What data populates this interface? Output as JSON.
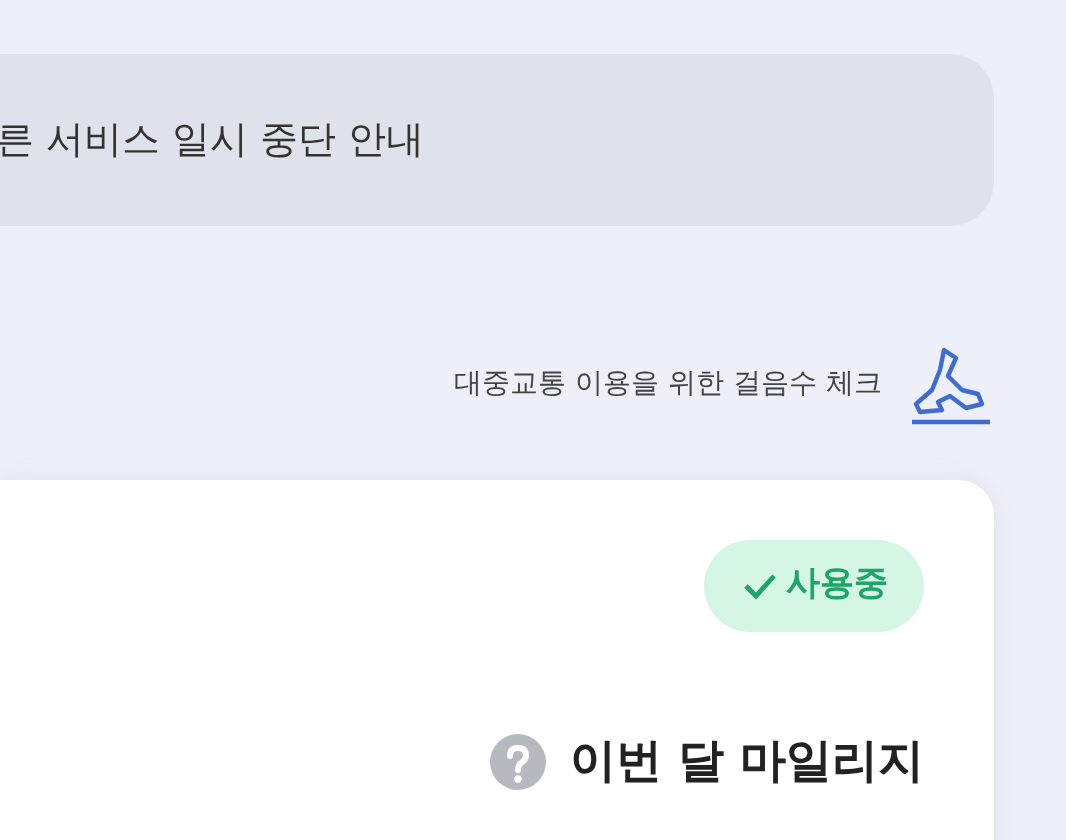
{
  "notice": {
    "text": "른 서비스 일시 중단 안내"
  },
  "step_check": {
    "label": "대중교통 이용을 위한 걸음수 체크"
  },
  "card": {
    "status": {
      "label": "사용중",
      "active": true
    },
    "mileage_title": "이번 달 마일리지"
  }
}
